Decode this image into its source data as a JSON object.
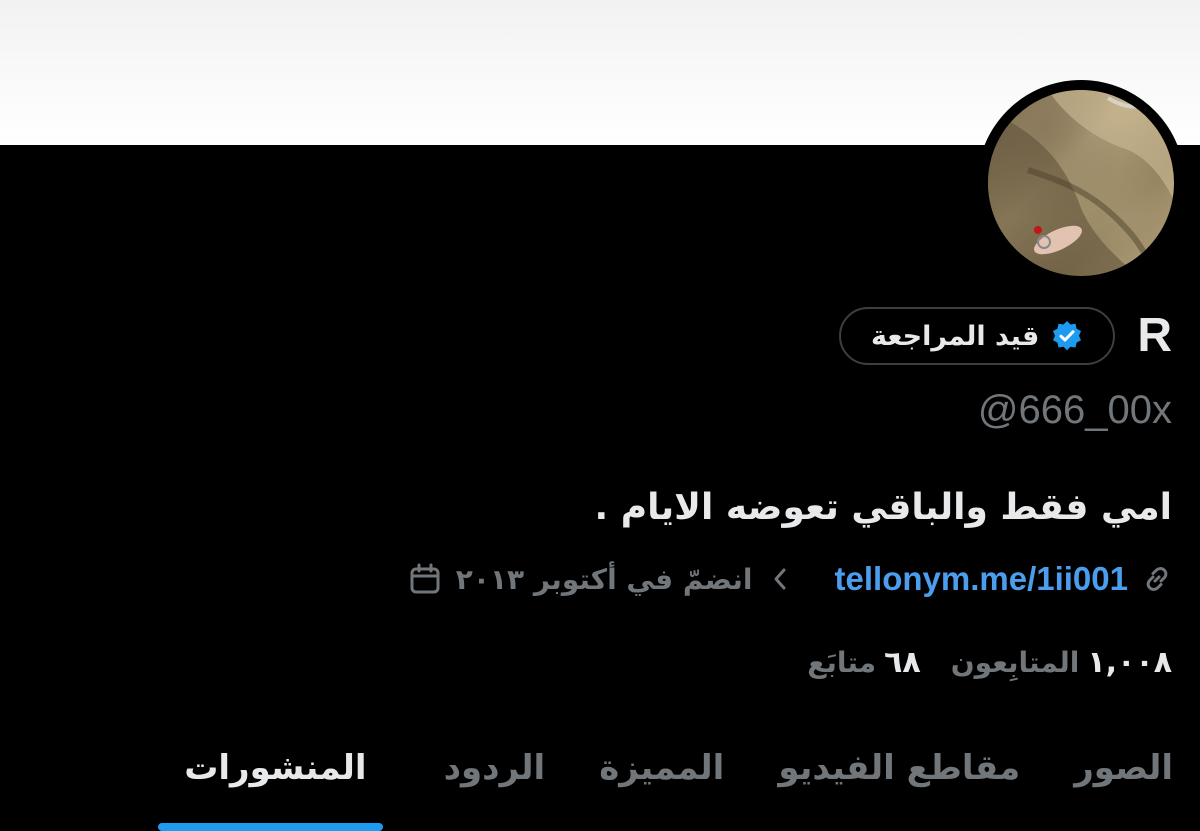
{
  "profile": {
    "display_name": "R",
    "verified_label": "قيد المراجعة",
    "handle": "@666_00x",
    "bio": "امي فقط والباقي تعوضه الايام .",
    "link": "tellonym.me/1ii001",
    "joined": "انضمّ في أكتوبر ٢٠١٣"
  },
  "stats": {
    "following_count": "٦٨",
    "following_label": "متابَع",
    "followers_count": "١,٠٠٨",
    "followers_label": "المتابِعون"
  },
  "tabs": [
    {
      "label": "المنشورات",
      "active": true
    },
    {
      "label": "الردود",
      "active": false
    },
    {
      "label": "المميزة",
      "active": false
    },
    {
      "label": "مقاطع الفيديو",
      "active": false
    },
    {
      "label": "الصور",
      "active": false
    }
  ],
  "colors": {
    "background": "#000000",
    "accent": "#1d9bf0",
    "link": "#4b9ded",
    "muted_text": "#71767b",
    "primary_text": "#e7e9ea"
  },
  "icons": [
    "verified-badge-icon",
    "link-icon",
    "chevron-icon",
    "calendar-icon"
  ]
}
